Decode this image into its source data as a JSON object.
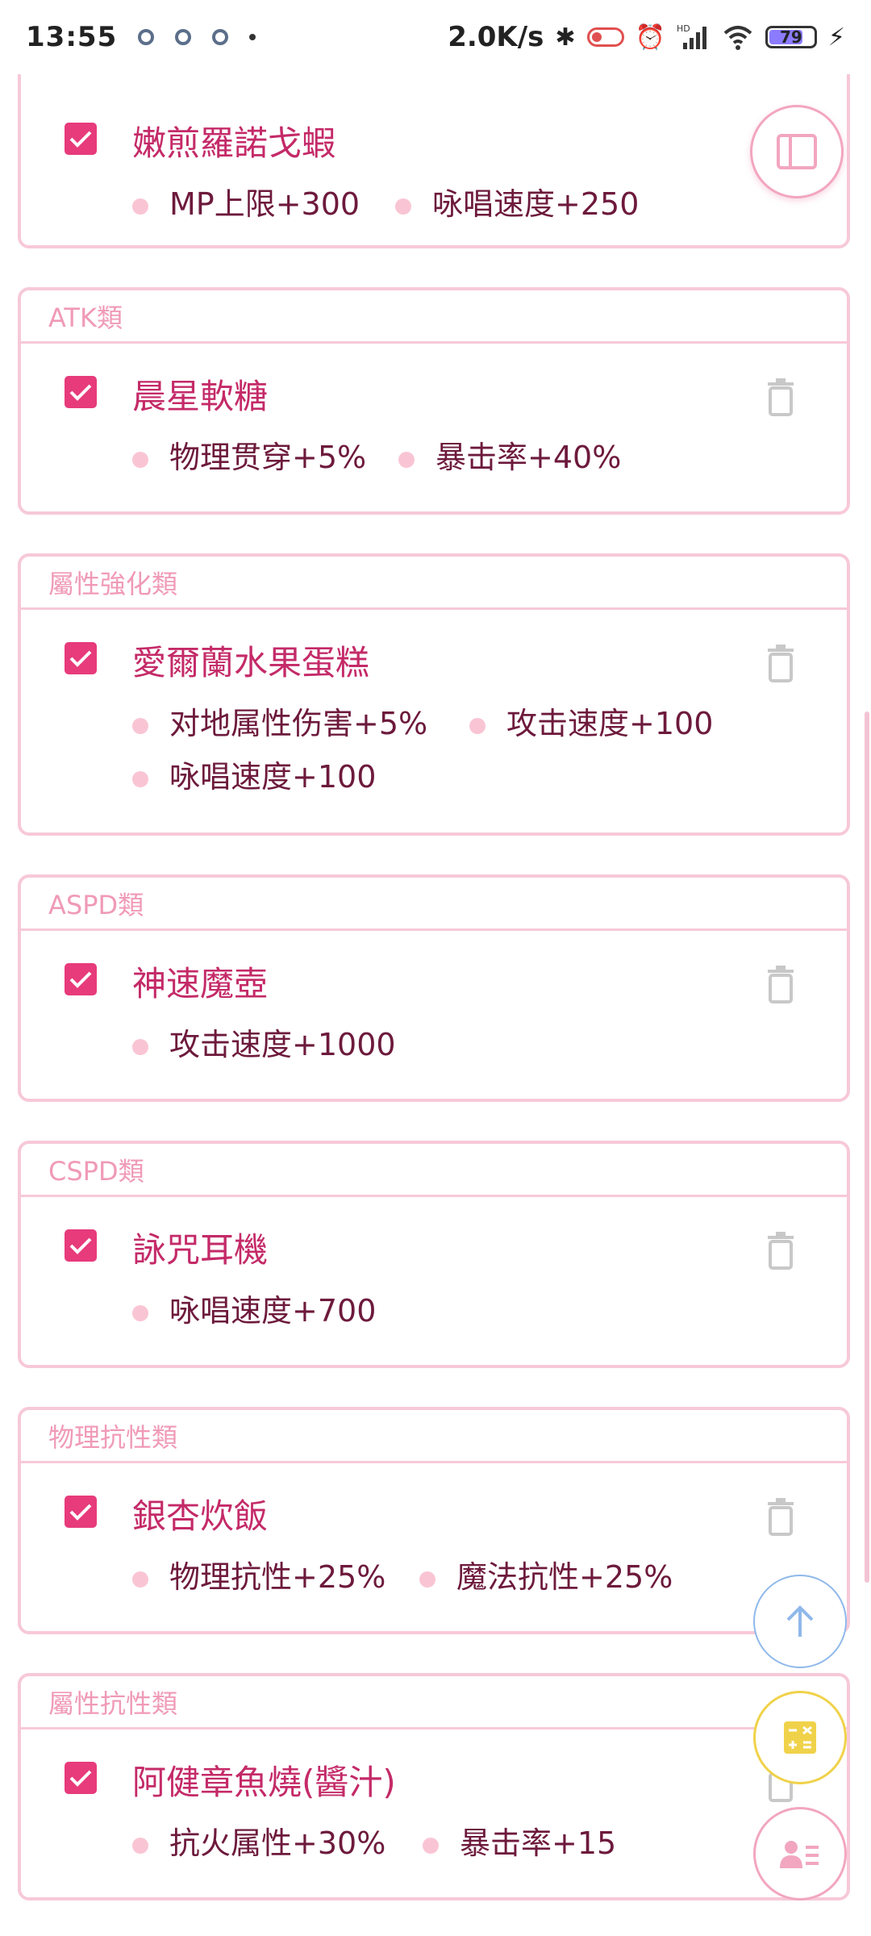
{
  "status_bar": {
    "time": "13:55",
    "net_speed": "2.0K/s",
    "signal_label": "HD",
    "battery": "79"
  },
  "cards": [
    {
      "header": "",
      "item": {
        "name": "嫩煎羅諾戈蝦",
        "stats": [
          "MP上限+300",
          "咏唱速度+250"
        ]
      }
    },
    {
      "header": "ATK類",
      "item": {
        "name": "晨星軟糖",
        "stats": [
          "物理贯穿+5%",
          "暴击率+40%"
        ]
      }
    },
    {
      "header": "屬性強化類",
      "item": {
        "name": "愛爾蘭水果蛋糕",
        "stats": [
          "对地属性伤害+5%",
          "攻击速度+100",
          "咏唱速度+100"
        ]
      }
    },
    {
      "header": "ASPD類",
      "item": {
        "name": "神速魔壺",
        "stats": [
          "攻击速度+1000"
        ]
      }
    },
    {
      "header": "CSPD類",
      "item": {
        "name": "詠咒耳機",
        "stats": [
          "咏唱速度+700"
        ]
      }
    },
    {
      "header": "物理抗性類",
      "item": {
        "name": "銀杏炊飯",
        "stats": [
          "物理抗性+25%",
          "魔法抗性+25%"
        ]
      }
    },
    {
      "header": "屬性抗性類",
      "item": {
        "name": "阿健章魚燒(醬汁)",
        "stats": [
          "抗火属性+30%",
          "暴击率+15"
        ]
      }
    }
  ],
  "fabs": [
    {
      "icon": "sidebar-toggle-icon",
      "color": "#f2a6c0"
    },
    {
      "icon": "arrow-up-icon",
      "color": "#8fb8ea"
    },
    {
      "icon": "calculator-icon",
      "color": "#f0d24a"
    },
    {
      "icon": "user-list-icon",
      "color": "#f2a6c0"
    }
  ],
  "colors": {
    "accent": "#e73b7b",
    "border": "#f7c9d8",
    "header_text": "#f09ab7",
    "item_name": "#c42a68",
    "stat_text": "#6d1a3c"
  }
}
